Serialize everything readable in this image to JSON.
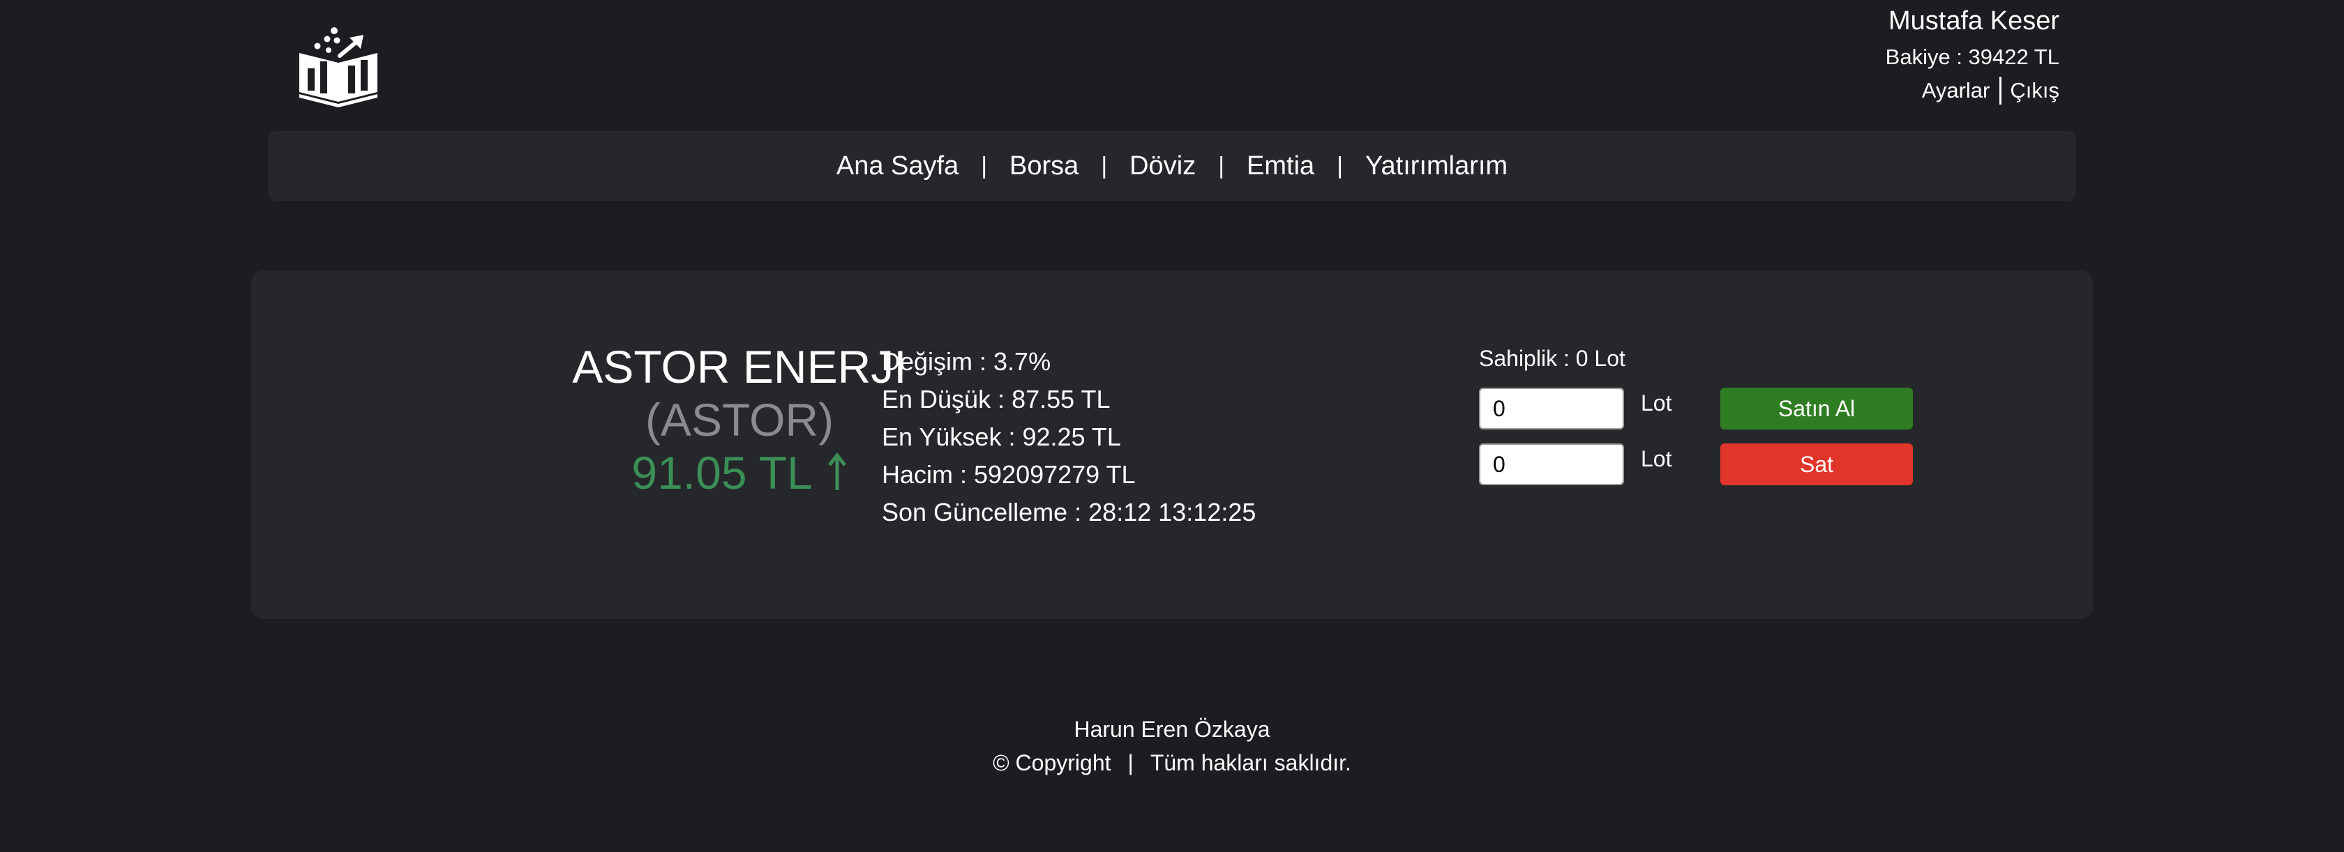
{
  "header": {
    "logo_icon": "book-growth-logo-icon",
    "user_name": "Mustafa Keser",
    "balance_label": "Bakiye : 39422 TL",
    "settings_link": "Ayarlar",
    "logout_link": "Çıkış"
  },
  "nav": {
    "items": [
      {
        "label": "Ana Sayfa"
      },
      {
        "label": "Borsa"
      },
      {
        "label": "Döviz"
      },
      {
        "label": "Emtia"
      },
      {
        "label": "Yatırımlarım"
      }
    ],
    "separator": "|"
  },
  "stock": {
    "name": "ASTOR ENERJI",
    "code": "(ASTOR)",
    "price": "91.05 TL",
    "trend_icon": "arrow-up-icon",
    "trend_color": "#3b8f56"
  },
  "stats": {
    "change": "Değişim : 3.7%",
    "low": "En Düşük : 87.55 TL",
    "high": "En Yüksek : 92.25 TL",
    "volume": "Hacim : 592097279 TL",
    "last_update": "Son Güncelleme : 28:12 13:12:25"
  },
  "trade": {
    "ownership": "Sahiplik : 0 Lot",
    "buy_quantity": "0",
    "sell_quantity": "0",
    "lot_label": "Lot",
    "buy_label": "Satın Al",
    "sell_label": "Sat",
    "buy_color": "#2f7d22",
    "sell_color": "#e2362b"
  },
  "footer": {
    "author": "Harun Eren Özkaya",
    "copyright": "© Copyright",
    "separator": "|",
    "rights": "Tüm hakları saklıdır."
  }
}
